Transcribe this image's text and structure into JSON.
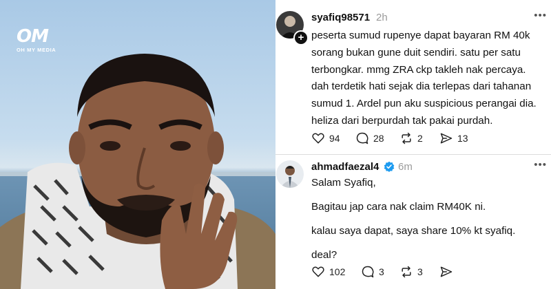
{
  "photo": {
    "logo": {
      "mark": "OM",
      "sub": "OH MY MEDIA"
    }
  },
  "posts": [
    {
      "username": "syafiq98571",
      "time": "2h",
      "more": "•••",
      "lines": [
        "peserta sumud rupenye dapat bayaran RM 40k",
        "sorang bukan gune duit sendiri. satu per satu",
        "terbongkar. mmg ZRA ckp takleh nak percaya.",
        "dah terdetik hati sejak dia terlepas dari tahanan",
        "sumud 1. Ardel pun aku suspicious perangai dia.",
        "heliza dari berpurdah tak pakai purdah."
      ],
      "likes": "94",
      "replies": "28",
      "reposts": "2",
      "shares": "13"
    },
    {
      "username": "ahmadfaezal4",
      "verified": true,
      "time": "6m",
      "more": "•••",
      "paragraphs": [
        "Salam Syafiq,",
        "Bagitau jap cara nak claim RM40K ni.",
        "kalau saya dapat, saya share 10% kt syafiq.",
        "deal?"
      ],
      "likes": "102",
      "replies": "3",
      "reposts": "3",
      "shares": ""
    }
  ],
  "colors": {
    "verified": "#1d9bf0",
    "divider": "#dcdcdc",
    "muted": "#9a9a9a"
  },
  "icons": [
    "heart-icon",
    "comment-icon",
    "repost-icon",
    "share-icon",
    "more-icon",
    "verified-badge-icon",
    "plus-icon"
  ]
}
